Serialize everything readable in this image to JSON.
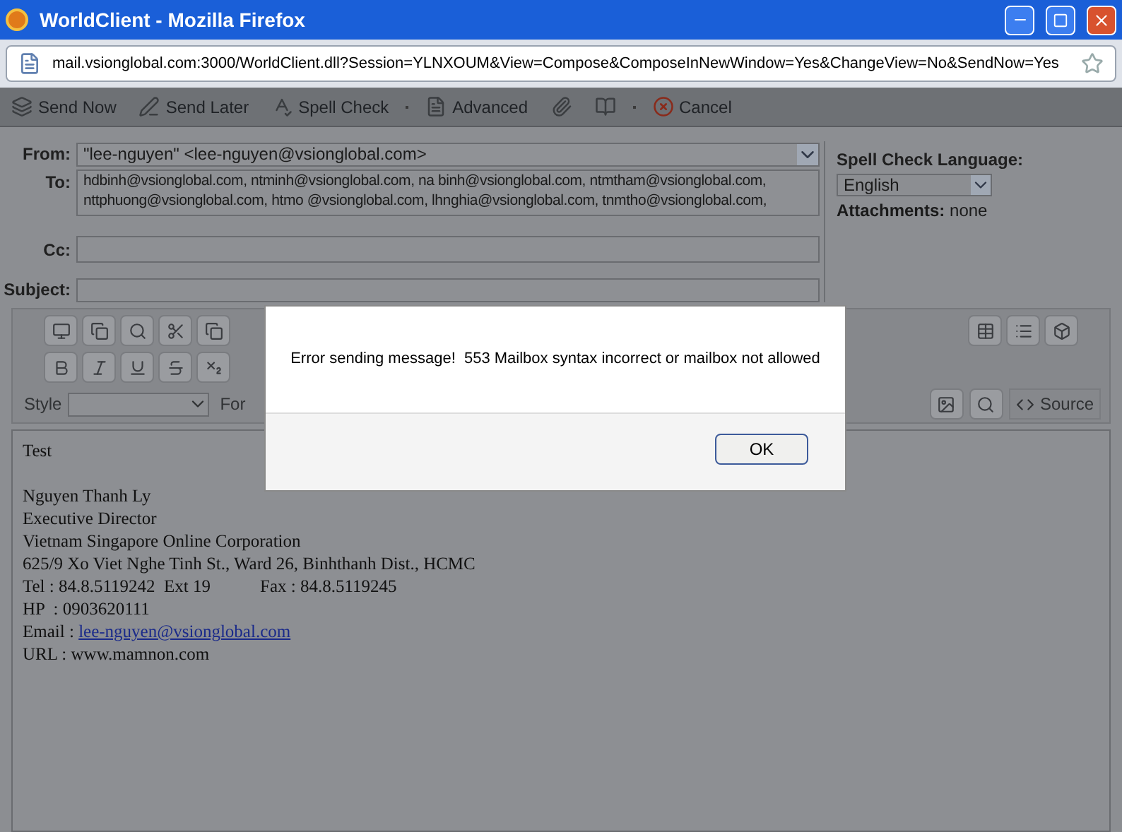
{
  "window": {
    "title": "WorldClient - Mozilla Firefox"
  },
  "address_bar": {
    "url": "mail.vsionglobal.com:3000/WorldClient.dll?Session=YLNXOUM&View=Compose&ComposeInNewWindow=Yes&ChangeView=No&SendNow=Yes"
  },
  "toolbar": [
    {
      "kind": "stack",
      "label": "Send Now"
    },
    {
      "kind": "pencil",
      "label": "Send Later"
    },
    {
      "kind": "spell",
      "label": "Spell Check"
    },
    {
      "kind": "sep"
    },
    {
      "kind": "doc",
      "label": "Advanced"
    },
    {
      "kind": "clip"
    },
    {
      "kind": "book"
    },
    {
      "kind": "sep"
    },
    {
      "kind": "cancel",
      "label": "Cancel"
    }
  ],
  "compose": {
    "from_label": "From:",
    "from_value": "\"lee-nguyen\" <lee-nguyen@vsionglobal.com>",
    "to_label": "To:",
    "to_lines": [
      "hdbinh@vsionglobal.com, ntminh@vsionglobal.com, na binh@vsionglobal.com, ntmtham@vsionglobal.com,",
      "nttphuong@vsionglobal.com, htmo @vsionglobal.com, lhnghia@vsionglobal.com, tnmtho@vsionglobal.com,"
    ],
    "cc_label": "Cc:",
    "subject_label": "Subject:"
  },
  "side_panel": {
    "spell_label": "Spell Check Language:",
    "spell_value": "English",
    "attachments_label": "Attachments:",
    "attachments_value": "none"
  },
  "editor_toolbar": {
    "style_label": "Style",
    "format_label": "For",
    "source_label": "Source"
  },
  "body": {
    "lines": [
      "Test",
      "Nguyen Thanh Ly",
      "Executive Director",
      "Vietnam Singapore Online Corporation",
      "625/9 Xo Viet Nghe Tinh St., Ward 26, Binhthanh Dist., HCMC"
    ],
    "tel": "Tel : 84.8.5119242  Ext 19",
    "fax": "Fax : 84.8.5119245",
    "hp": "HP  : 0903620111",
    "email_label": "Email : ",
    "email_link": "lee-nguyen@vsionglobal.com",
    "url": "URL : www.mamnon.com"
  },
  "dialog": {
    "message": "Error sending message!  553 Mailbox syntax incorrect or mailbox not allowed",
    "ok": "OK"
  }
}
